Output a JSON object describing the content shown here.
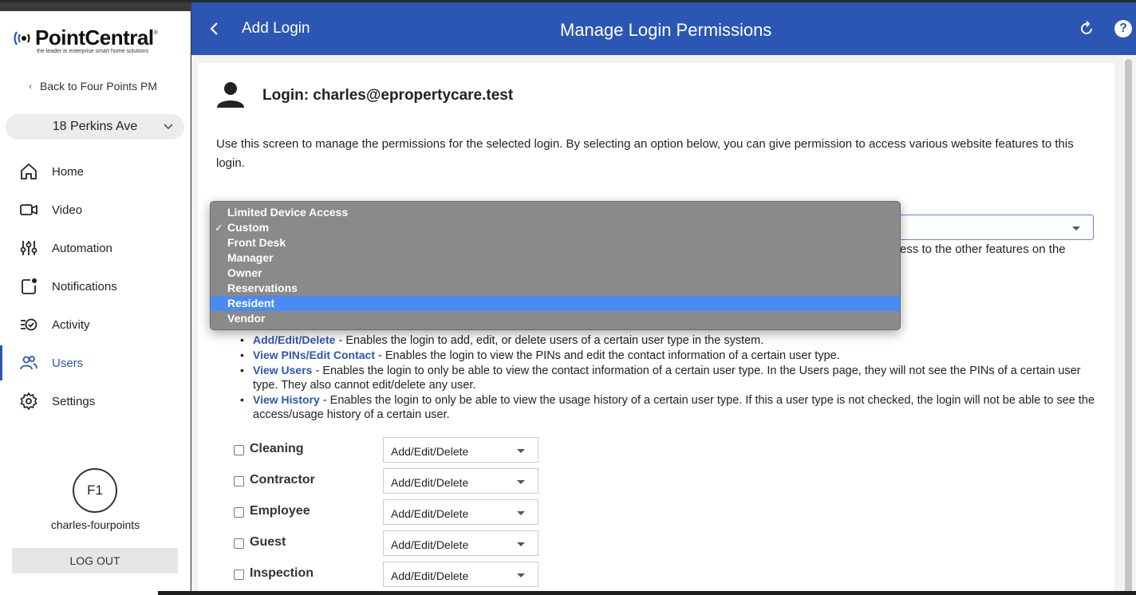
{
  "brand": {
    "name": "PointCentral",
    "registered": "®",
    "tagline": "the leader in enterprise smart home solutions"
  },
  "sidebar": {
    "back_label": "Back to Four Points PM",
    "property": "18 Perkins Ave",
    "items": [
      {
        "label": "Home",
        "icon": "home-icon"
      },
      {
        "label": "Video",
        "icon": "video-icon"
      },
      {
        "label": "Automation",
        "icon": "sliders-icon"
      },
      {
        "label": "Notifications",
        "icon": "notification-icon"
      },
      {
        "label": "Activity",
        "icon": "activity-icon"
      },
      {
        "label": "Users",
        "icon": "users-icon",
        "active": true
      },
      {
        "label": "Settings",
        "icon": "gear-icon"
      }
    ],
    "avatar_initials": "F1",
    "username": "charles-fourpoints",
    "logout_label": "LOG OUT"
  },
  "header": {
    "back_label": "Add Login",
    "title": "Manage Login Permissions",
    "refresh_icon": "refresh-icon",
    "help_label": "?"
  },
  "main": {
    "login_title": "Login: charles@epropertycare.test",
    "intro": "Use this screen to manage the permissions for the selected login. By selecting an option below, you can give permission to access various website features to this login.",
    "partial_text": "ess to the other features on the",
    "role_dropdown": {
      "options": [
        "Limited Device Access",
        "Custom",
        "Front Desk",
        "Manager",
        "Owner",
        "Reservations",
        "Resident",
        "Vendor"
      ],
      "checked": "Custom",
      "highlighted": "Resident"
    },
    "permissions": [
      {
        "term": "Add/Edit/Delete",
        "desc": " - Enables the login to add, edit, or delete users of a certain user type in the system."
      },
      {
        "term": "View PINs/Edit Contact",
        "desc": " - Enables the login to view the PINs and edit the contact information of a certain user type."
      },
      {
        "term": "View Users",
        "desc": " - Enables the login to only be able to view the contact information of a certain user type. In the Users page, they will not see the PINs of a certain user type. They also cannot edit/delete any user."
      },
      {
        "term": "View History",
        "desc": " - Enables the login to only be able to view the usage history of a certain user type. If this a user type is not checked, the login will not be able to see the access/usage history of a certain user."
      }
    ],
    "user_types": [
      {
        "label": "Cleaning",
        "permission": "Add/Edit/Delete"
      },
      {
        "label": "Contractor",
        "permission": "Add/Edit/Delete"
      },
      {
        "label": "Employee",
        "permission": "Add/Edit/Delete"
      },
      {
        "label": "Guest",
        "permission": "Add/Edit/Delete"
      },
      {
        "label": "Inspection",
        "permission": "Add/Edit/Delete"
      }
    ]
  },
  "colors": {
    "primary": "#2b56b3",
    "highlight": "#4a8af4",
    "dropdown_bg": "#8a8a8a"
  }
}
